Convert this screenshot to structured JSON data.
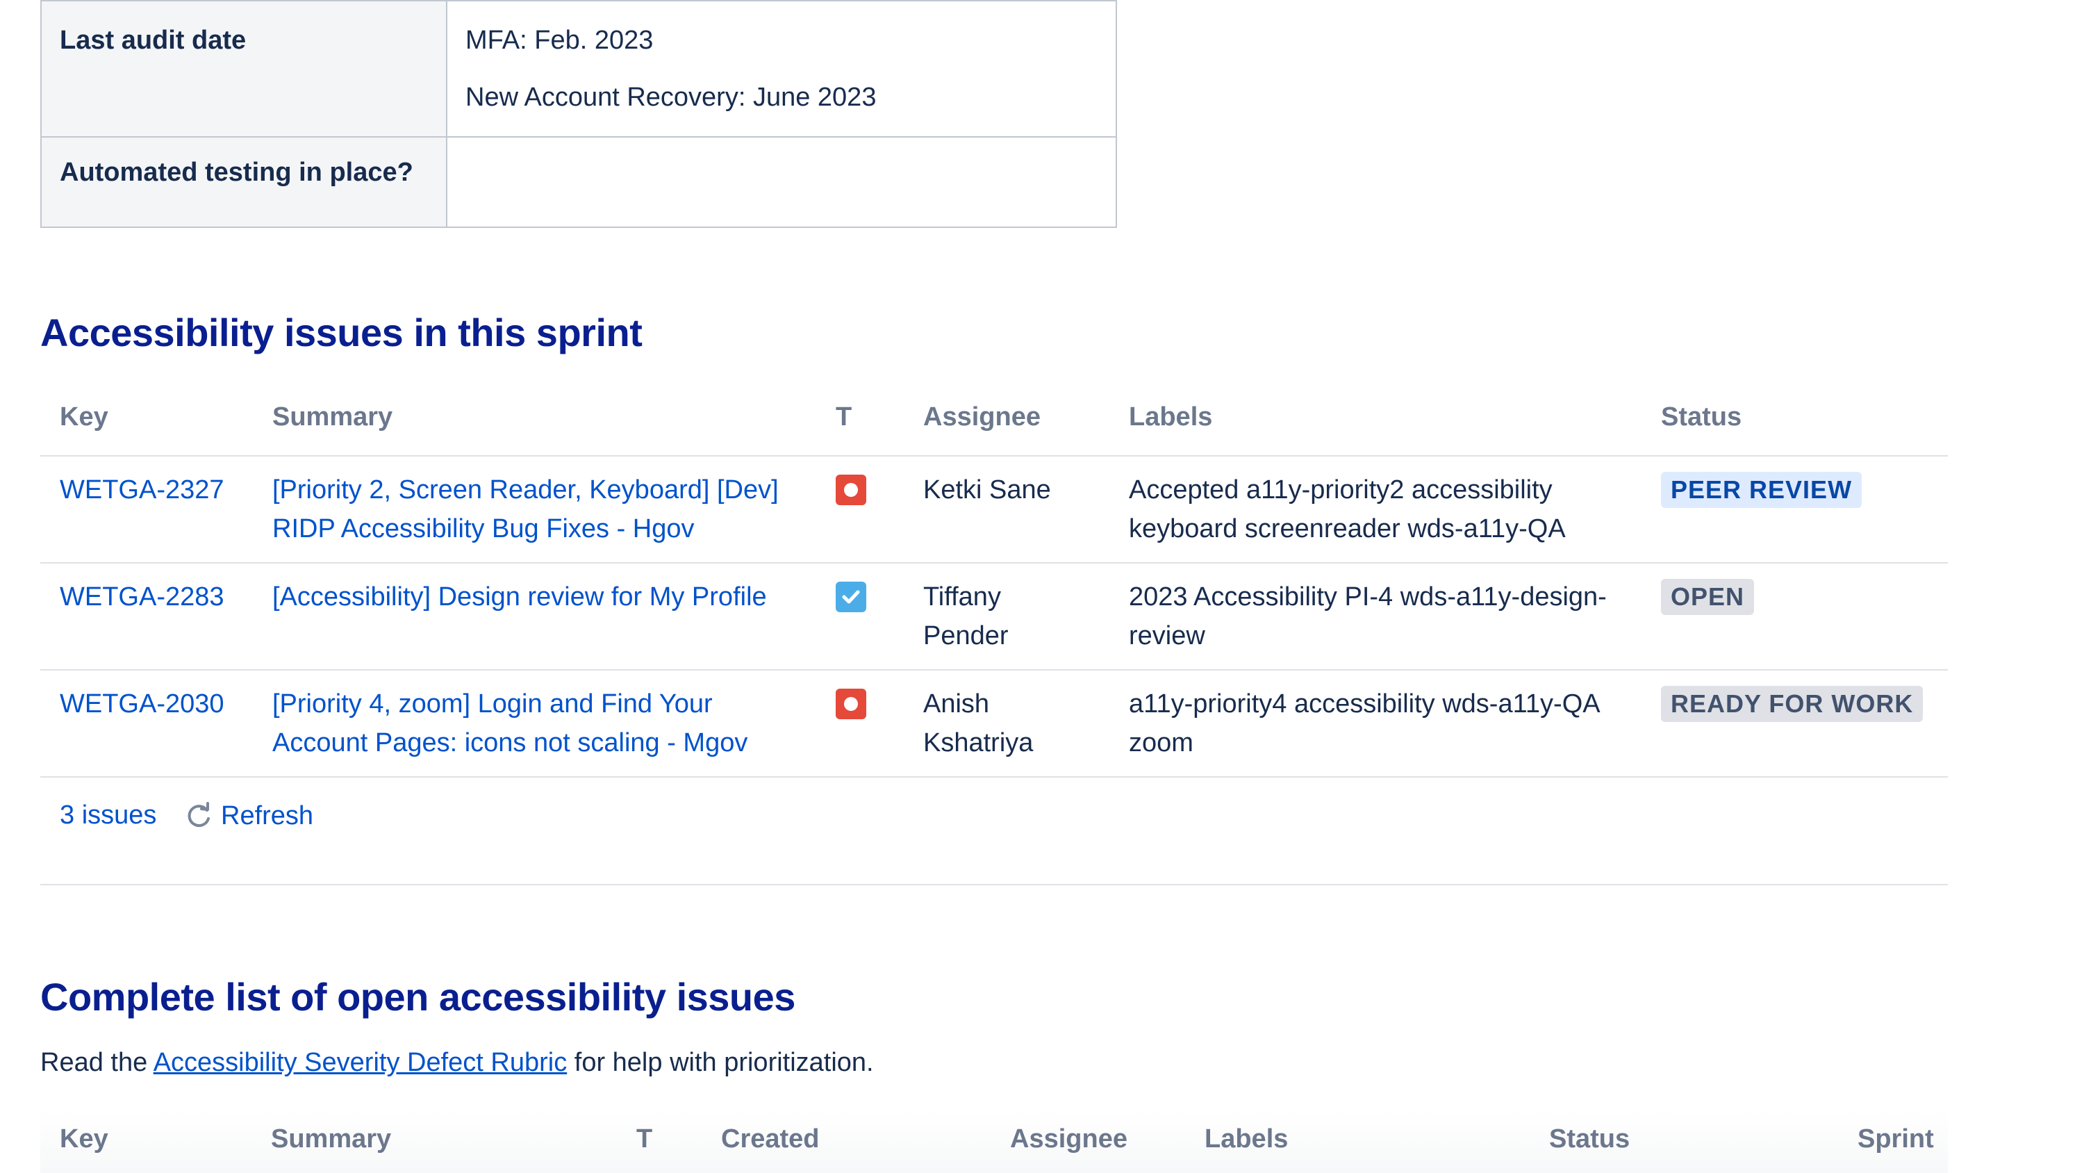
{
  "info_table": {
    "rows": [
      {
        "label": "Last audit date",
        "values": [
          "MFA: Feb. 2023",
          "New Account Recovery: June 2023"
        ]
      },
      {
        "label": "Automated testing in place?",
        "values": []
      }
    ]
  },
  "sprint_section": {
    "heading": "Accessibility issues in this sprint",
    "columns": [
      "Key",
      "Summary",
      "T",
      "Assignee",
      "Labels",
      "Status"
    ],
    "issues": [
      {
        "key": "WETGA-2327",
        "summary": "[Priority 2, Screen Reader, Keyboard] [Dev] RIDP Accessibility Bug Fixes - Hgov",
        "type_icon": "bug-icon",
        "assignee": "Ketki Sane",
        "labels": "Accepted a11y-priority2 accessibility keyboard screenreader wds-a11y-QA",
        "status": "PEER REVIEW",
        "status_color": "#deebff"
      },
      {
        "key": "WETGA-2283",
        "summary": "[Accessibility] Design review for My Profile",
        "type_icon": "task-icon",
        "assignee": "Tiffany Pender",
        "labels": "2023 Accessibility PI-4 wds-a11y-design-review",
        "status": "OPEN",
        "status_color": "#dfe1e6"
      },
      {
        "key": "WETGA-2030",
        "summary": "[Priority 4, zoom] Login and Find Your Account Pages: icons not scaling - Mgov",
        "type_icon": "bug-icon",
        "assignee": "Anish Kshatriya",
        "labels": "a11y-priority4 accessibility wds-a11y-QA zoom",
        "status": "READY FOR WORK",
        "status_color": "#dfe1e6"
      }
    ],
    "count_label": "3 issues",
    "refresh_label": "Refresh"
  },
  "complete_section": {
    "heading": "Complete list of open accessibility issues",
    "intro_prefix": "Read the ",
    "intro_link": "Accessibility Severity Defect Rubric",
    "intro_suffix": " for help with prioritization.",
    "columns": [
      "Key",
      "Summary",
      "T",
      "Created",
      "Assignee",
      "Labels",
      "Status",
      "Sprint"
    ]
  },
  "colors": {
    "heading": "#0a1f8f",
    "link": "#0052cc",
    "bug": "#e5493a",
    "task": "#4bade8"
  }
}
